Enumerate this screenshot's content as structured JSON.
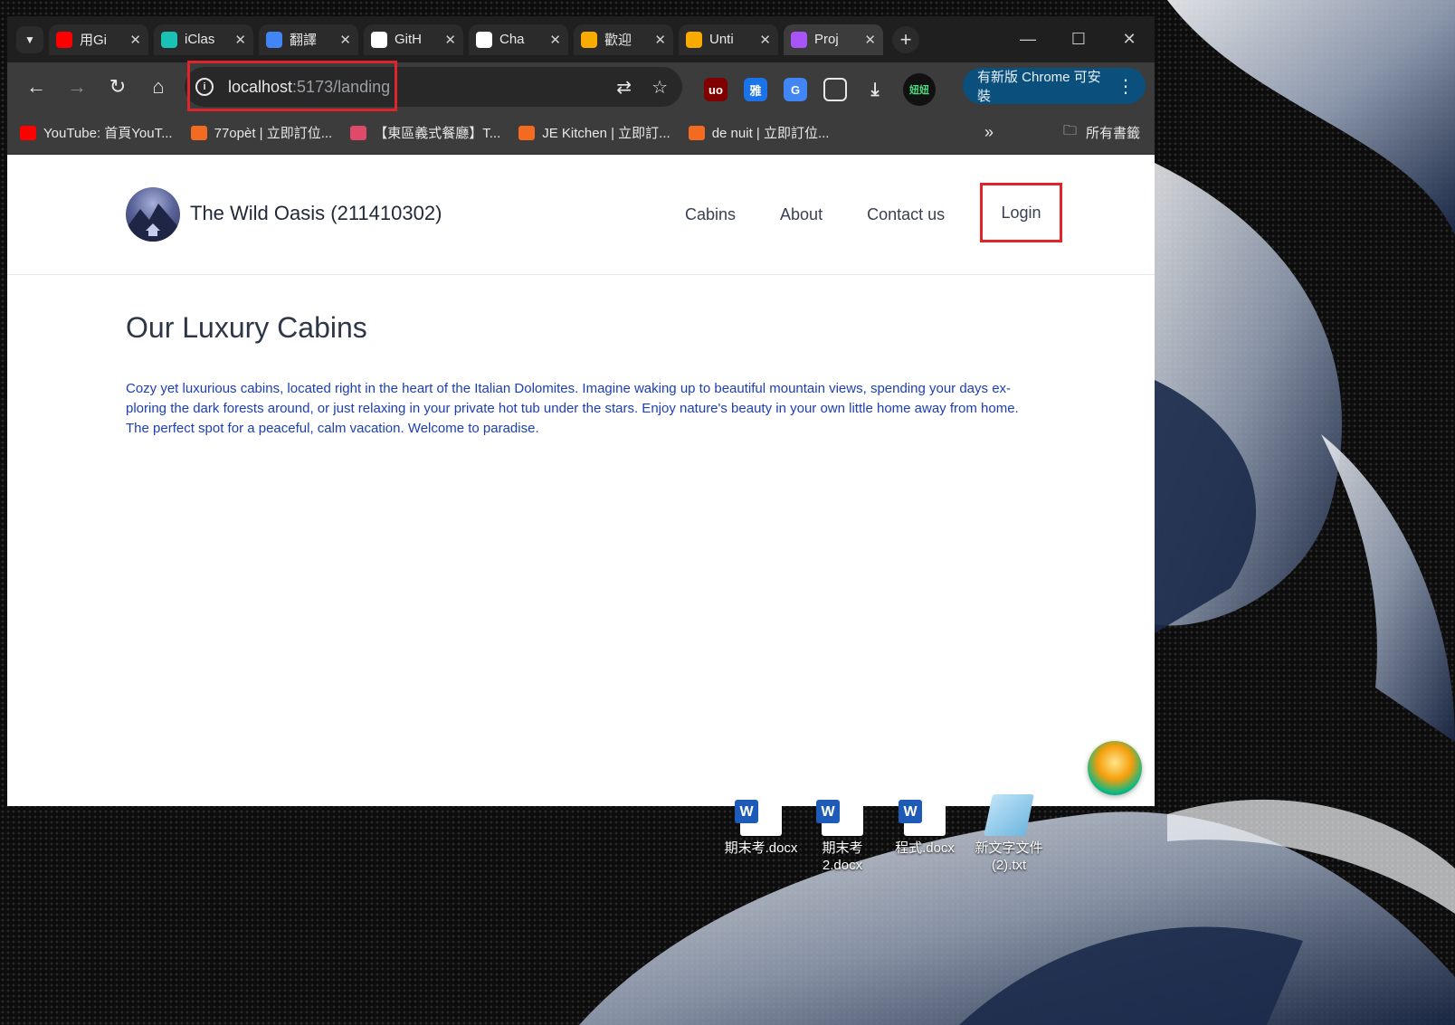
{
  "browser": {
    "tabs": [
      {
        "title": "用Gi",
        "icon": "youtube-icon",
        "color": "#ff0000"
      },
      {
        "title": "iClas",
        "icon": "iclass-icon",
        "color": "#19c2b4"
      },
      {
        "title": "翻譯",
        "icon": "google-icon",
        "color": "#4285f4"
      },
      {
        "title": "GitH",
        "icon": "github-icon",
        "color": "#ffffff"
      },
      {
        "title": "Cha",
        "icon": "chatgpt-icon",
        "color": "#ffffff"
      },
      {
        "title": "歡迎",
        "icon": "colab-icon",
        "color": "#f9ab00"
      },
      {
        "title": "Unti",
        "icon": "colab-icon",
        "color": "#f9ab00"
      },
      {
        "title": "Proj",
        "icon": "vite-icon",
        "color": "#a855f7",
        "active": true
      }
    ],
    "url_host": "localhost",
    "url_rest": ":5173/landing",
    "update_button": "有新版 Chrome 可安裝",
    "bookmarks": [
      {
        "label": "YouTube: 首頁YouT...",
        "icon": "youtube-icon",
        "color": "#ff0000"
      },
      {
        "label": "77opèt | 立即訂位...",
        "icon": "inline-icon",
        "color": "#f26b21"
      },
      {
        "label": "【東區義式餐廳】T...",
        "icon": "flower-icon",
        "color": "#e04a6a"
      },
      {
        "label": "JE Kitchen | 立即訂...",
        "icon": "inline-icon",
        "color": "#f26b21"
      },
      {
        "label": "de nuit | 立即訂位...",
        "icon": "inline-icon",
        "color": "#f26b21"
      }
    ],
    "all_bookmarks": "所有書籤",
    "profile_badge": "妞妞",
    "ext_yahoo": "雅"
  },
  "site": {
    "title": "The Wild Oasis (211410302)",
    "nav": [
      "Cabins",
      "About",
      "Contact us"
    ],
    "login": "Login",
    "heading": "Our Luxury Cabins",
    "description": "Cozy yet luxurious cabins, located right in the heart of the Italian Dolomites. Imagine waking up to beautiful mountain views, spending your days ex-ploring the dark forests around, or just relaxing in your private hot tub under the stars. Enjoy nature's beauty in your own little home away from home. The perfect spot for a peaceful, calm vacation. Welcome to paradise."
  },
  "desktop": {
    "icons": [
      {
        "label": "期末考.docx",
        "type": "word"
      },
      {
        "label": "期末考\n2.docx",
        "type": "word"
      },
      {
        "label": "程式.docx",
        "type": "word"
      },
      {
        "label": "新文字文件\n(2).txt",
        "type": "text"
      }
    ]
  }
}
